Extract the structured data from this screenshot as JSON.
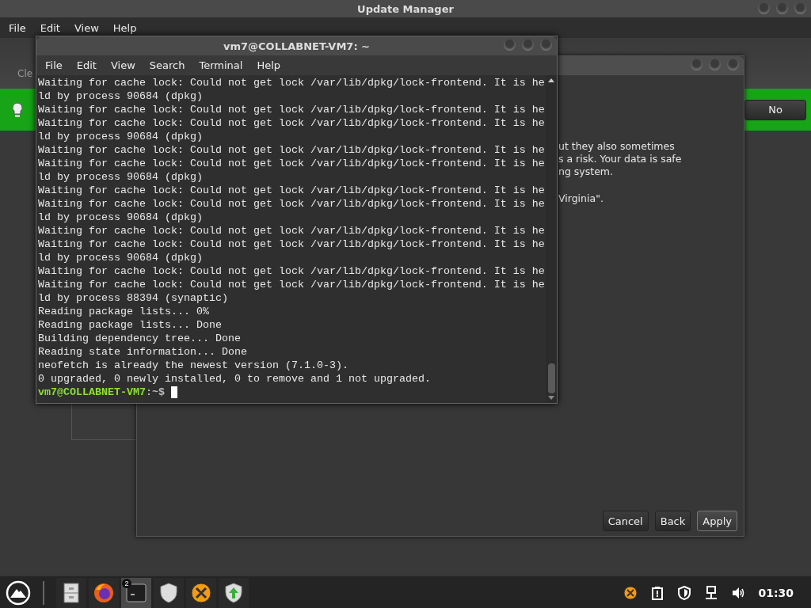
{
  "update_manager": {
    "title": "Update Manager",
    "menu": [
      "File",
      "Edit",
      "View",
      "Help"
    ],
    "toolbar_label": "Cle",
    "info_bar": {
      "button": "No"
    }
  },
  "dialog": {
    "paragraphs": [
      [
        "ut they also sometimes",
        "s a risk. Your data is safe",
        "ng system."
      ],
      [
        "Virginia\"."
      ]
    ],
    "buttons": [
      {
        "label": "Cancel",
        "kind": "plain"
      },
      {
        "label": "Back",
        "kind": "plain"
      },
      {
        "label": "Apply",
        "kind": "default"
      }
    ]
  },
  "terminal": {
    "title": "vm7@COLLABNET-VM7: ~",
    "menu": [
      "File",
      "Edit",
      "View",
      "Search",
      "Terminal",
      "Help"
    ],
    "lines": [
      {
        "kind": "output",
        "text": "Waiting for cache lock: Could not get lock /var/lib/dpkg/lock-frontend. It is he"
      },
      {
        "kind": "output",
        "text": "ld by process 90684 (dpkg)"
      },
      {
        "kind": "output",
        "text": "Waiting for cache lock: Could not get lock /var/lib/dpkg/lock-frontend. It is he"
      },
      {
        "kind": "output",
        "text": "Waiting for cache lock: Could not get lock /var/lib/dpkg/lock-frontend. It is he"
      },
      {
        "kind": "output",
        "text": "ld by process 90684 (dpkg)"
      },
      {
        "kind": "output",
        "text": "Waiting for cache lock: Could not get lock /var/lib/dpkg/lock-frontend. It is he"
      },
      {
        "kind": "output",
        "text": "Waiting for cache lock: Could not get lock /var/lib/dpkg/lock-frontend. It is he"
      },
      {
        "kind": "output",
        "text": "ld by process 90684 (dpkg)"
      },
      {
        "kind": "output",
        "text": "Waiting for cache lock: Could not get lock /var/lib/dpkg/lock-frontend. It is he"
      },
      {
        "kind": "output",
        "text": "Waiting for cache lock: Could not get lock /var/lib/dpkg/lock-frontend. It is he"
      },
      {
        "kind": "output",
        "text": "ld by process 90684 (dpkg)"
      },
      {
        "kind": "output",
        "text": "Waiting for cache lock: Could not get lock /var/lib/dpkg/lock-frontend. It is he"
      },
      {
        "kind": "output",
        "text": "Waiting for cache lock: Could not get lock /var/lib/dpkg/lock-frontend. It is he"
      },
      {
        "kind": "output",
        "text": "ld by process 90684 (dpkg)"
      },
      {
        "kind": "output",
        "text": "Waiting for cache lock: Could not get lock /var/lib/dpkg/lock-frontend. It is he"
      },
      {
        "kind": "output",
        "text": "Waiting for cache lock: Could not get lock /var/lib/dpkg/lock-frontend. It is he"
      },
      {
        "kind": "output",
        "text": "ld by process 88394 (synaptic)"
      },
      {
        "kind": "output",
        "text": "Reading package lists... 0%"
      },
      {
        "kind": "output",
        "text": "Reading package lists... Done"
      },
      {
        "kind": "output",
        "text": "Building dependency tree... Done"
      },
      {
        "kind": "output",
        "text": "Reading state information... Done"
      },
      {
        "kind": "output",
        "text": "neofetch is already the newest version (7.1.0-3)."
      },
      {
        "kind": "output",
        "text": "0 upgraded, 0 newly installed, 0 to remove and 1 not upgraded."
      },
      {
        "kind": "prompt",
        "user_host": "vm7@COLLABNET-VM7",
        "path": ":~$"
      }
    ]
  },
  "taskbar": {
    "apps": [
      {
        "kind": "files",
        "selected": false
      },
      {
        "kind": "browser",
        "selected": false
      },
      {
        "kind": "terminal",
        "selected": true,
        "badge": "2"
      },
      {
        "kind": "shield",
        "selected": false
      },
      {
        "kind": "xapp",
        "selected": false
      },
      {
        "kind": "update",
        "selected": false
      }
    ],
    "tray": [
      {
        "kind": "xapp"
      },
      {
        "kind": "clipboard"
      },
      {
        "kind": "shield"
      },
      {
        "kind": "network"
      },
      {
        "kind": "volume"
      }
    ],
    "clock": "01:30"
  }
}
